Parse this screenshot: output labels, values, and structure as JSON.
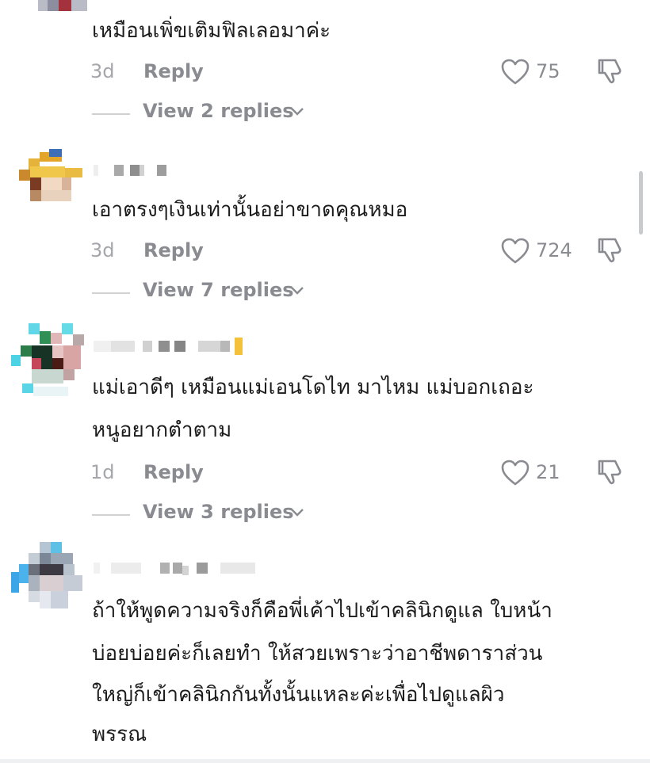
{
  "comments": [
    {
      "text": "เหมือนเพิ่ขเติมฟิลเลอมาค่ะ",
      "age": "3d",
      "reply_label": "Reply",
      "likes": "75",
      "view_replies": "View 2 replies"
    },
    {
      "text": "เอาตรงๆเงินเท่านั้นอย่าขาดคุณหมอ",
      "age": "3d",
      "reply_label": "Reply",
      "likes": "724",
      "view_replies": "View 7 replies"
    },
    {
      "text_line1": "แม่เอาดีๆ เหมือนแม่เอนโดไท มาไหม แม่บอกเถอะ",
      "text_line2": "หนูอยากตำตาม",
      "age": "1d",
      "reply_label": "Reply",
      "likes": "21",
      "view_replies": "View 3 replies"
    },
    {
      "text_line1": "ถ้าให้พูดความจริงก็คือพี่เค้าไปเข้าคลินิกดูแล ใบหน้า",
      "text_line2": "บ่อยบ่อยค่ะก็เลยทำ ให้สวยเพราะว่าอาชีพดาราส่วน",
      "text_line3": "ใหญ่ก็เข้าคลินิกกันทั้งนั้นแหละค่ะเพื่อไปดูแลผิว",
      "text_line4": "พรรณ"
    }
  ],
  "colors": {
    "text": "#1c1c1c",
    "secondary": "#8a8b91",
    "background": "#ffffff"
  }
}
